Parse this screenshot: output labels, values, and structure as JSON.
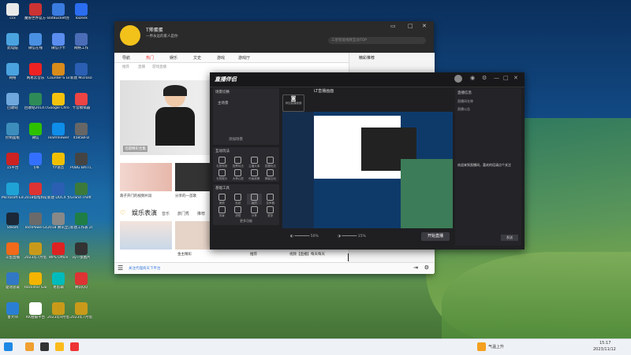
{
  "desktop": {
    "icons": [
      {
        "label": "ccx",
        "color": "#e9e9e9"
      },
      {
        "label": "魔兽世界官方平台",
        "color": "#c33"
      },
      {
        "label": "BatBucket创建方式",
        "color": "#3a7be0"
      },
      {
        "label": "ToDesk",
        "color": "#2a6df0"
      },
      {
        "label": "此电脑",
        "color": "#4aa3df"
      },
      {
        "label": "微信在线",
        "color": "#4a90e2"
      },
      {
        "label": "微信小卡",
        "color": "#5b8def"
      },
      {
        "label": "网络工作",
        "color": "#4b6cb7"
      },
      {
        "label": "网络",
        "color": "#4aa3df"
      },
      {
        "label": "网易云音乐",
        "color": "#e22"
      },
      {
        "label": "Counter-S Global Off",
        "color": "#d98b1b"
      },
      {
        "label": "新建 Microsoft...",
        "color": "#2b5fb3"
      },
      {
        "label": "回收站",
        "color": "#6fa8dc"
      },
      {
        "label": "回收站2014.06",
        "color": "#2e8b57"
      },
      {
        "label": "Google Chrome",
        "color": "#f4c20d"
      },
      {
        "label": "卡音模拟器",
        "color": "#e44"
      },
      {
        "label": "控制面板",
        "color": "#3c8dbc"
      },
      {
        "label": "微信",
        "color": "#2dc100"
      },
      {
        "label": "TeamViewer",
        "color": "#0e8ee9"
      },
      {
        "label": "4585BFD",
        "color": "#666"
      },
      {
        "label": "15平台",
        "color": "#c22"
      },
      {
        "label": "飞书",
        "color": "#3370ff"
      },
      {
        "label": "YY语音",
        "color": "#f0c000"
      },
      {
        "label": "PUBG BATTLEGR...",
        "color": "#444"
      },
      {
        "label": "Microsoft Edge",
        "color": "#1fa3d6"
      },
      {
        "label": "2018帮帮和软件下载",
        "color": "#d33"
      },
      {
        "label": "新建 DOCX 文档",
        "color": "#2b5fb3"
      },
      {
        "label": "Grand Theft Auto V",
        "color": "#3b7a3b"
      },
      {
        "label": "Steam",
        "color": "#1b2838"
      },
      {
        "label": "TechPowe GPU-Z",
        "color": "#6a6a6a"
      },
      {
        "label": "2018 腾讯立游戏平台",
        "color": "#888"
      },
      {
        "label": "新建工作表 2022",
        "color": "#1e7e45"
      },
      {
        "label": "斗鱼直播",
        "color": "#f06a1a"
      },
      {
        "label": "2023年7月借来",
        "color": "#c99a1a"
      },
      {
        "label": "WPS Office",
        "color": "#d22"
      },
      {
        "label": "vy一张图片",
        "color": "#333"
      },
      {
        "label": "驱动总裁",
        "color": "#3178c6"
      },
      {
        "label": "Rockstar Games...",
        "color": "#f5b400"
      },
      {
        "label": "易剪辑",
        "color": "#0bb"
      },
      {
        "label": "腾讯QQ",
        "color": "#d33"
      },
      {
        "label": "鲁大师",
        "color": "#2a7fd4"
      },
      {
        "label": "KK拍摄平台",
        "color": "#fff"
      },
      {
        "label": "2023年9月借来",
        "color": "#c99a1a"
      },
      {
        "label": "2023年7月借来",
        "color": "#c99a1a"
      }
    ]
  },
  "app_window": {
    "username": "T帅蛋蛋",
    "subtitle": "一界永远的家人是你",
    "search_placeholder": "三星智能视频互动TOP",
    "nav": [
      "导航",
      "热门",
      "娱乐",
      "文史",
      "游戏",
      "游戏厅"
    ],
    "subnav": [
      "推荐",
      "直播",
      "游戏直播"
    ],
    "feature_caption": "话题精彩合集",
    "feature_sub": "1.2亿热度",
    "thumb_captions": [
      "葫子开门的视频片段",
      "分享的一首歌"
    ],
    "section_title": "娱乐表演",
    "section_tabs": [
      "音乐",
      "旅门秀",
      "推荐"
    ],
    "bottom_labels": [
      "金主精彩",
      "推荐",
      "视频【直播】每天每天"
    ],
    "bottom_bar": "关注代理商天下平台",
    "right_labels": [
      "精彩推荐"
    ],
    "badge": "订阅视频"
  },
  "stream_window": {
    "logo": "直播伴侣",
    "scene_title": "场景切换",
    "scene_item": "主场景",
    "add_scene": "添加场景",
    "panels": [
      {
        "title": "互动玩法",
        "items": [
          "礼物特效",
          "投票玩法",
          "主播大事",
          "答题玩法",
          "礼物展示",
          "大神心愿",
          "你画我猜",
          "弹幕互动"
        ]
      },
      {
        "title": "基础工具",
        "items": [
          "美颜",
          "贴纸",
          "画质",
          "变声器",
          "背景",
          "滤镜",
          "分享",
          "更多"
        ]
      }
    ],
    "more_tools": "更多功能",
    "center_title": "LT直播画面",
    "add_source": "添加直播画面",
    "volume_left": "50%",
    "volume_right": "15%",
    "start_button": "开始直播",
    "right_title": "直播信息",
    "right_items": [
      "直播间名称",
      "直播公告"
    ],
    "right_notice": "欢迎来到直播间，喜欢的话请点个关注",
    "right_button": "发送"
  },
  "taskbar": {
    "weather": "气温上升",
    "time": "15:17",
    "date": "2023/11/12"
  }
}
